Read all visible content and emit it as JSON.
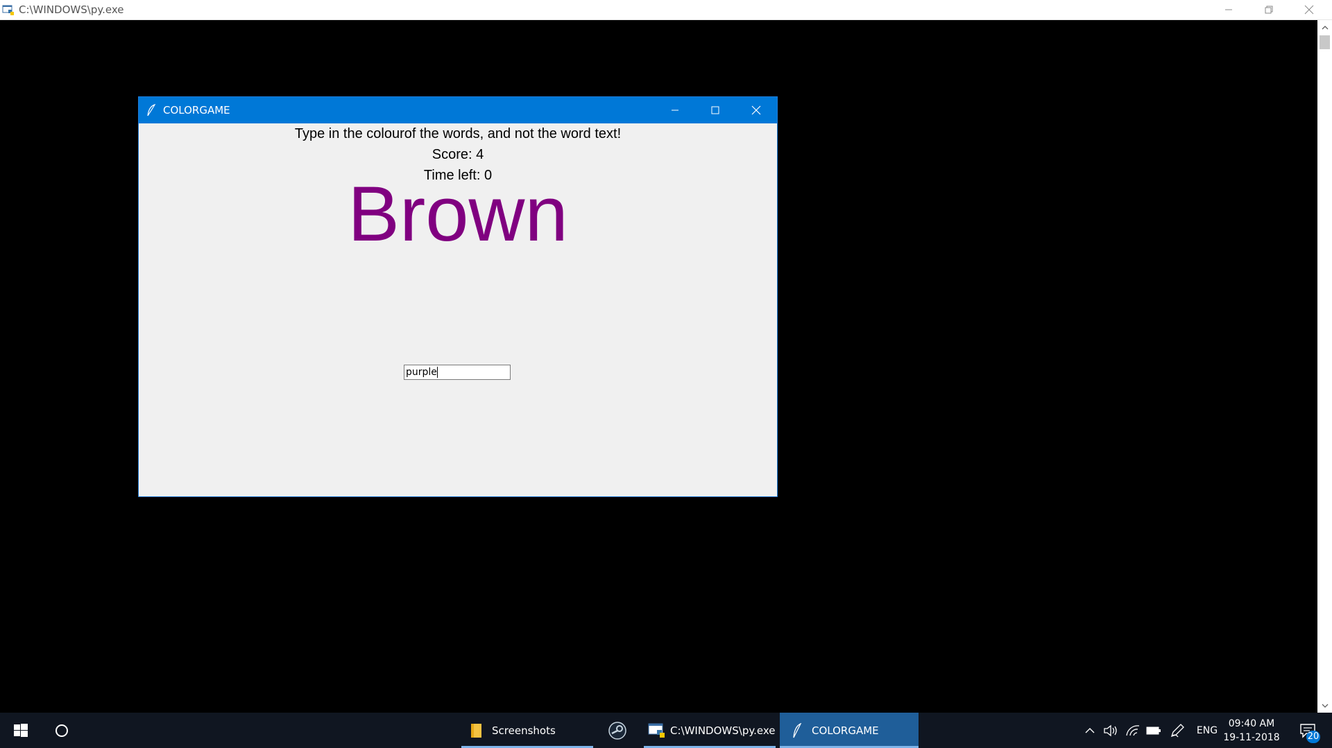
{
  "console": {
    "title": "C:\\WINDOWS\\py.exe",
    "controls": [
      "minimize-icon",
      "restore-icon",
      "close-icon"
    ]
  },
  "game_window": {
    "title": "COLORGAME",
    "instructions": "Type in the colourof the words, and not the word text!",
    "score_text": "Score: 4",
    "time_text": "Time left: 0",
    "word": "Brown",
    "word_color": "#800080",
    "input_value": "purple",
    "titlebar_color": "#0078d7"
  },
  "taskbar": {
    "apps": [
      {
        "label": "Screenshots",
        "icon": "folder-icon",
        "active": false
      },
      {
        "label": "",
        "icon": "steam-icon",
        "active": false
      },
      {
        "label": "C:\\WINDOWS\\py.exe",
        "icon": "python-icon",
        "active": false
      },
      {
        "label": "COLORGAME",
        "icon": "feather-icon",
        "active": true
      }
    ],
    "language": "ENG",
    "time": "09:40 AM",
    "date": "19-11-2018",
    "notification_count": "20"
  }
}
